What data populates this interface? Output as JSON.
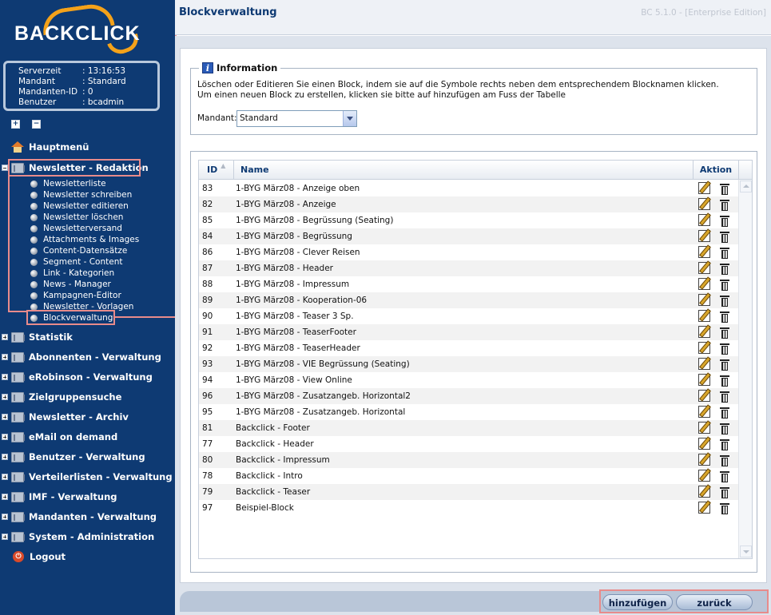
{
  "app": {
    "logo_text": "BACKCLICK",
    "version": "BC 5.1.0 - [Enterprise Edition]",
    "page_title": "Blockverwaltung"
  },
  "server_info": [
    {
      "key": "Serverzeit",
      "value": ": 13:16:53"
    },
    {
      "key": "Mandant",
      "value": ": Standard"
    },
    {
      "key": "Mandanten-ID",
      "value": ": 0"
    },
    {
      "key": "Benutzer",
      "value": ": bcadmin"
    }
  ],
  "tree_controls": {
    "expand": "+",
    "collapse": "−"
  },
  "menu": {
    "hauptmenu": "Hauptmenü",
    "newsletter_redaktion": "Newsletter - Redaktion",
    "sub_items": [
      "Newsletterliste",
      "Newsletter schreiben",
      "Newsletter editieren",
      "Newsletter löschen",
      "Newsletterversand",
      "Attachments & Images",
      "Content-Datensätze",
      "Segment - Content",
      "Link - Kategorien",
      "News - Manager",
      "Kampagnen-Editor",
      "Newsletter - Vorlagen",
      "Blockverwaltung"
    ],
    "sections": [
      "Statistik",
      "Abonnenten - Verwaltung",
      "eRobinson - Verwaltung",
      "Zielgruppensuche",
      "Newsletter - Archiv",
      "eMail on demand",
      "Benutzer - Verwaltung",
      "Verteilerlisten - Verwaltung",
      "IMF - Verwaltung",
      "Mandanten - Verwaltung",
      "System - Administration"
    ],
    "logout": "Logout"
  },
  "info": {
    "legend": "Information",
    "line1": "Löschen oder Editieren Sie einen Block, indem sie auf die Symbole rechts neben dem entsprechendem Blocknamen klicken.",
    "line2": "Um einen neuen Block zu erstellen, klicken sie bitte auf hinzufügen am Fuss der Tabelle",
    "mandant_label": "Mandant:",
    "mandant_value": "Standard"
  },
  "table": {
    "headers": {
      "id": "ID",
      "name": "Name",
      "action": "Aktion"
    },
    "rows": [
      {
        "id": "83",
        "name": "1-BYG März08 - Anzeige oben"
      },
      {
        "id": "82",
        "name": "1-BYG März08 - Anzeige"
      },
      {
        "id": "85",
        "name": "1-BYG März08 - Begrüssung (Seating)"
      },
      {
        "id": "84",
        "name": "1-BYG März08 - Begrüssung"
      },
      {
        "id": "86",
        "name": "1-BYG März08 - Clever Reisen"
      },
      {
        "id": "87",
        "name": "1-BYG März08 - Header"
      },
      {
        "id": "88",
        "name": "1-BYG März08 - Impressum"
      },
      {
        "id": "89",
        "name": "1-BYG März08 - Kooperation-06"
      },
      {
        "id": "90",
        "name": "1-BYG März08 - Teaser 3 Sp."
      },
      {
        "id": "91",
        "name": "1-BYG März08 - TeaserFooter"
      },
      {
        "id": "92",
        "name": "1-BYG März08 - TeaserHeader"
      },
      {
        "id": "93",
        "name": "1-BYG März08 - VIE Begrüssung (Seating)"
      },
      {
        "id": "94",
        "name": "1-BYG März08 - View Online"
      },
      {
        "id": "96",
        "name": "1-BYG März08 - Zusatzangeb. Horizontal2"
      },
      {
        "id": "95",
        "name": "1-BYG März08 - Zusatzangeb. Horizontal"
      },
      {
        "id": "81",
        "name": "Backclick - Footer"
      },
      {
        "id": "77",
        "name": "Backclick - Header"
      },
      {
        "id": "80",
        "name": "Backclick - Impressum"
      },
      {
        "id": "78",
        "name": "Backclick - Intro"
      },
      {
        "id": "79",
        "name": "Backclick - Teaser"
      },
      {
        "id": "97",
        "name": "Beispiel-Block"
      }
    ]
  },
  "buttons": {
    "add": "hinzufügen",
    "back": "zurück"
  },
  "colors": {
    "sidebar": "#0e3a73",
    "highlight": "#e88b8b",
    "accent": "#f4a21a"
  }
}
